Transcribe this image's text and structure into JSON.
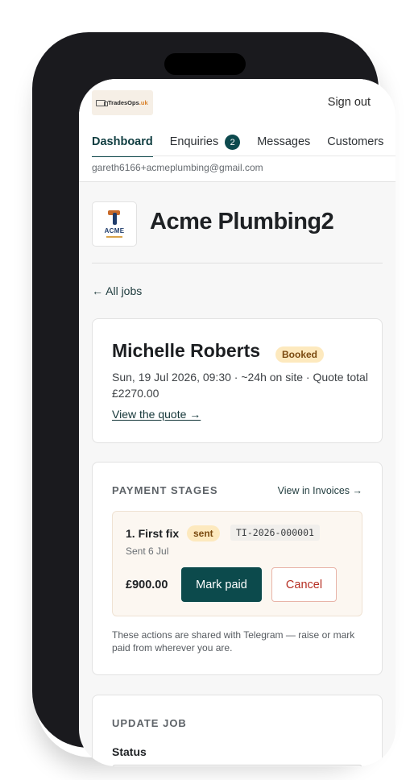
{
  "header": {
    "brand": "TradesOps",
    "sign_out": "Sign out"
  },
  "nav": {
    "items": [
      {
        "label": "Dashboard",
        "active": true
      },
      {
        "label": "Enquiries",
        "badge": "2"
      },
      {
        "label": "Messages"
      },
      {
        "label": "Customers"
      }
    ]
  },
  "account": {
    "email": "gareth6166+acmeplumbing@gmail.com"
  },
  "business": {
    "logo_text": "ACME",
    "name": "Acme Plumbing2"
  },
  "back_link": "← All jobs",
  "job": {
    "client": "Michelle Roberts",
    "status": "Booked",
    "details": "Sun, 19 Jul 2026, 09:30 · ~24h on site · Quote total £2270.00",
    "view_quote": "View the quote →"
  },
  "payments": {
    "title": "PAYMENT STAGES",
    "view_invoices": "View in Invoices →",
    "stage": {
      "title": "1. First fix",
      "status": "sent",
      "invoice": "TI-2026-000001",
      "sent_date": "Sent 6 Jul",
      "amount": "£900.00",
      "mark_paid": "Mark paid",
      "cancel": "Cancel"
    },
    "note": "These actions are shared with Telegram — raise or mark paid from wherever you are."
  },
  "update": {
    "title": "UPDATE JOB",
    "status_label": "Status"
  },
  "colors": {
    "accent": "#0c4a4c",
    "badge_bg": "#fde9be",
    "danger": "#b52e22"
  }
}
